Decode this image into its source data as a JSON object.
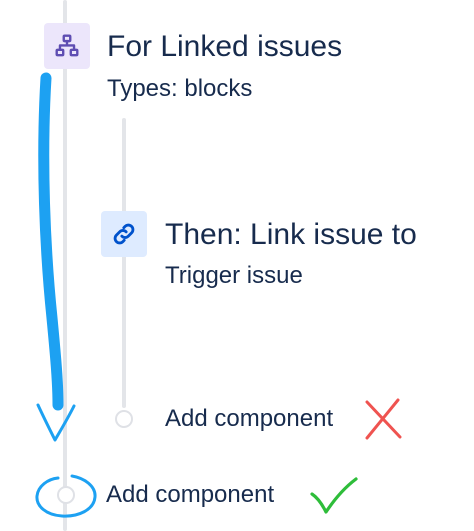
{
  "rule_steps": {
    "branch": {
      "icon": "branch-icon",
      "title": "For Linked issues",
      "subtitle": "Types: blocks"
    },
    "action": {
      "icon": "link-icon",
      "title": "Then: Link issue to",
      "subtitle": "Trigger issue"
    },
    "add_component_inner": {
      "label": "Add component",
      "mark": "cross-mark"
    },
    "add_component_outer": {
      "label": "Add component",
      "mark": "check-mark"
    }
  },
  "colors": {
    "text": "#172b4d",
    "connector": "#e3e5e9",
    "branch_tile": "#ece6fb",
    "branch_icon": "#5e4db2",
    "link_tile": "#deebff",
    "link_icon": "#0052cc",
    "annotation_blue": "#1da1f2",
    "annotation_red": "#ef5350",
    "annotation_green": "#2ebd3a"
  }
}
